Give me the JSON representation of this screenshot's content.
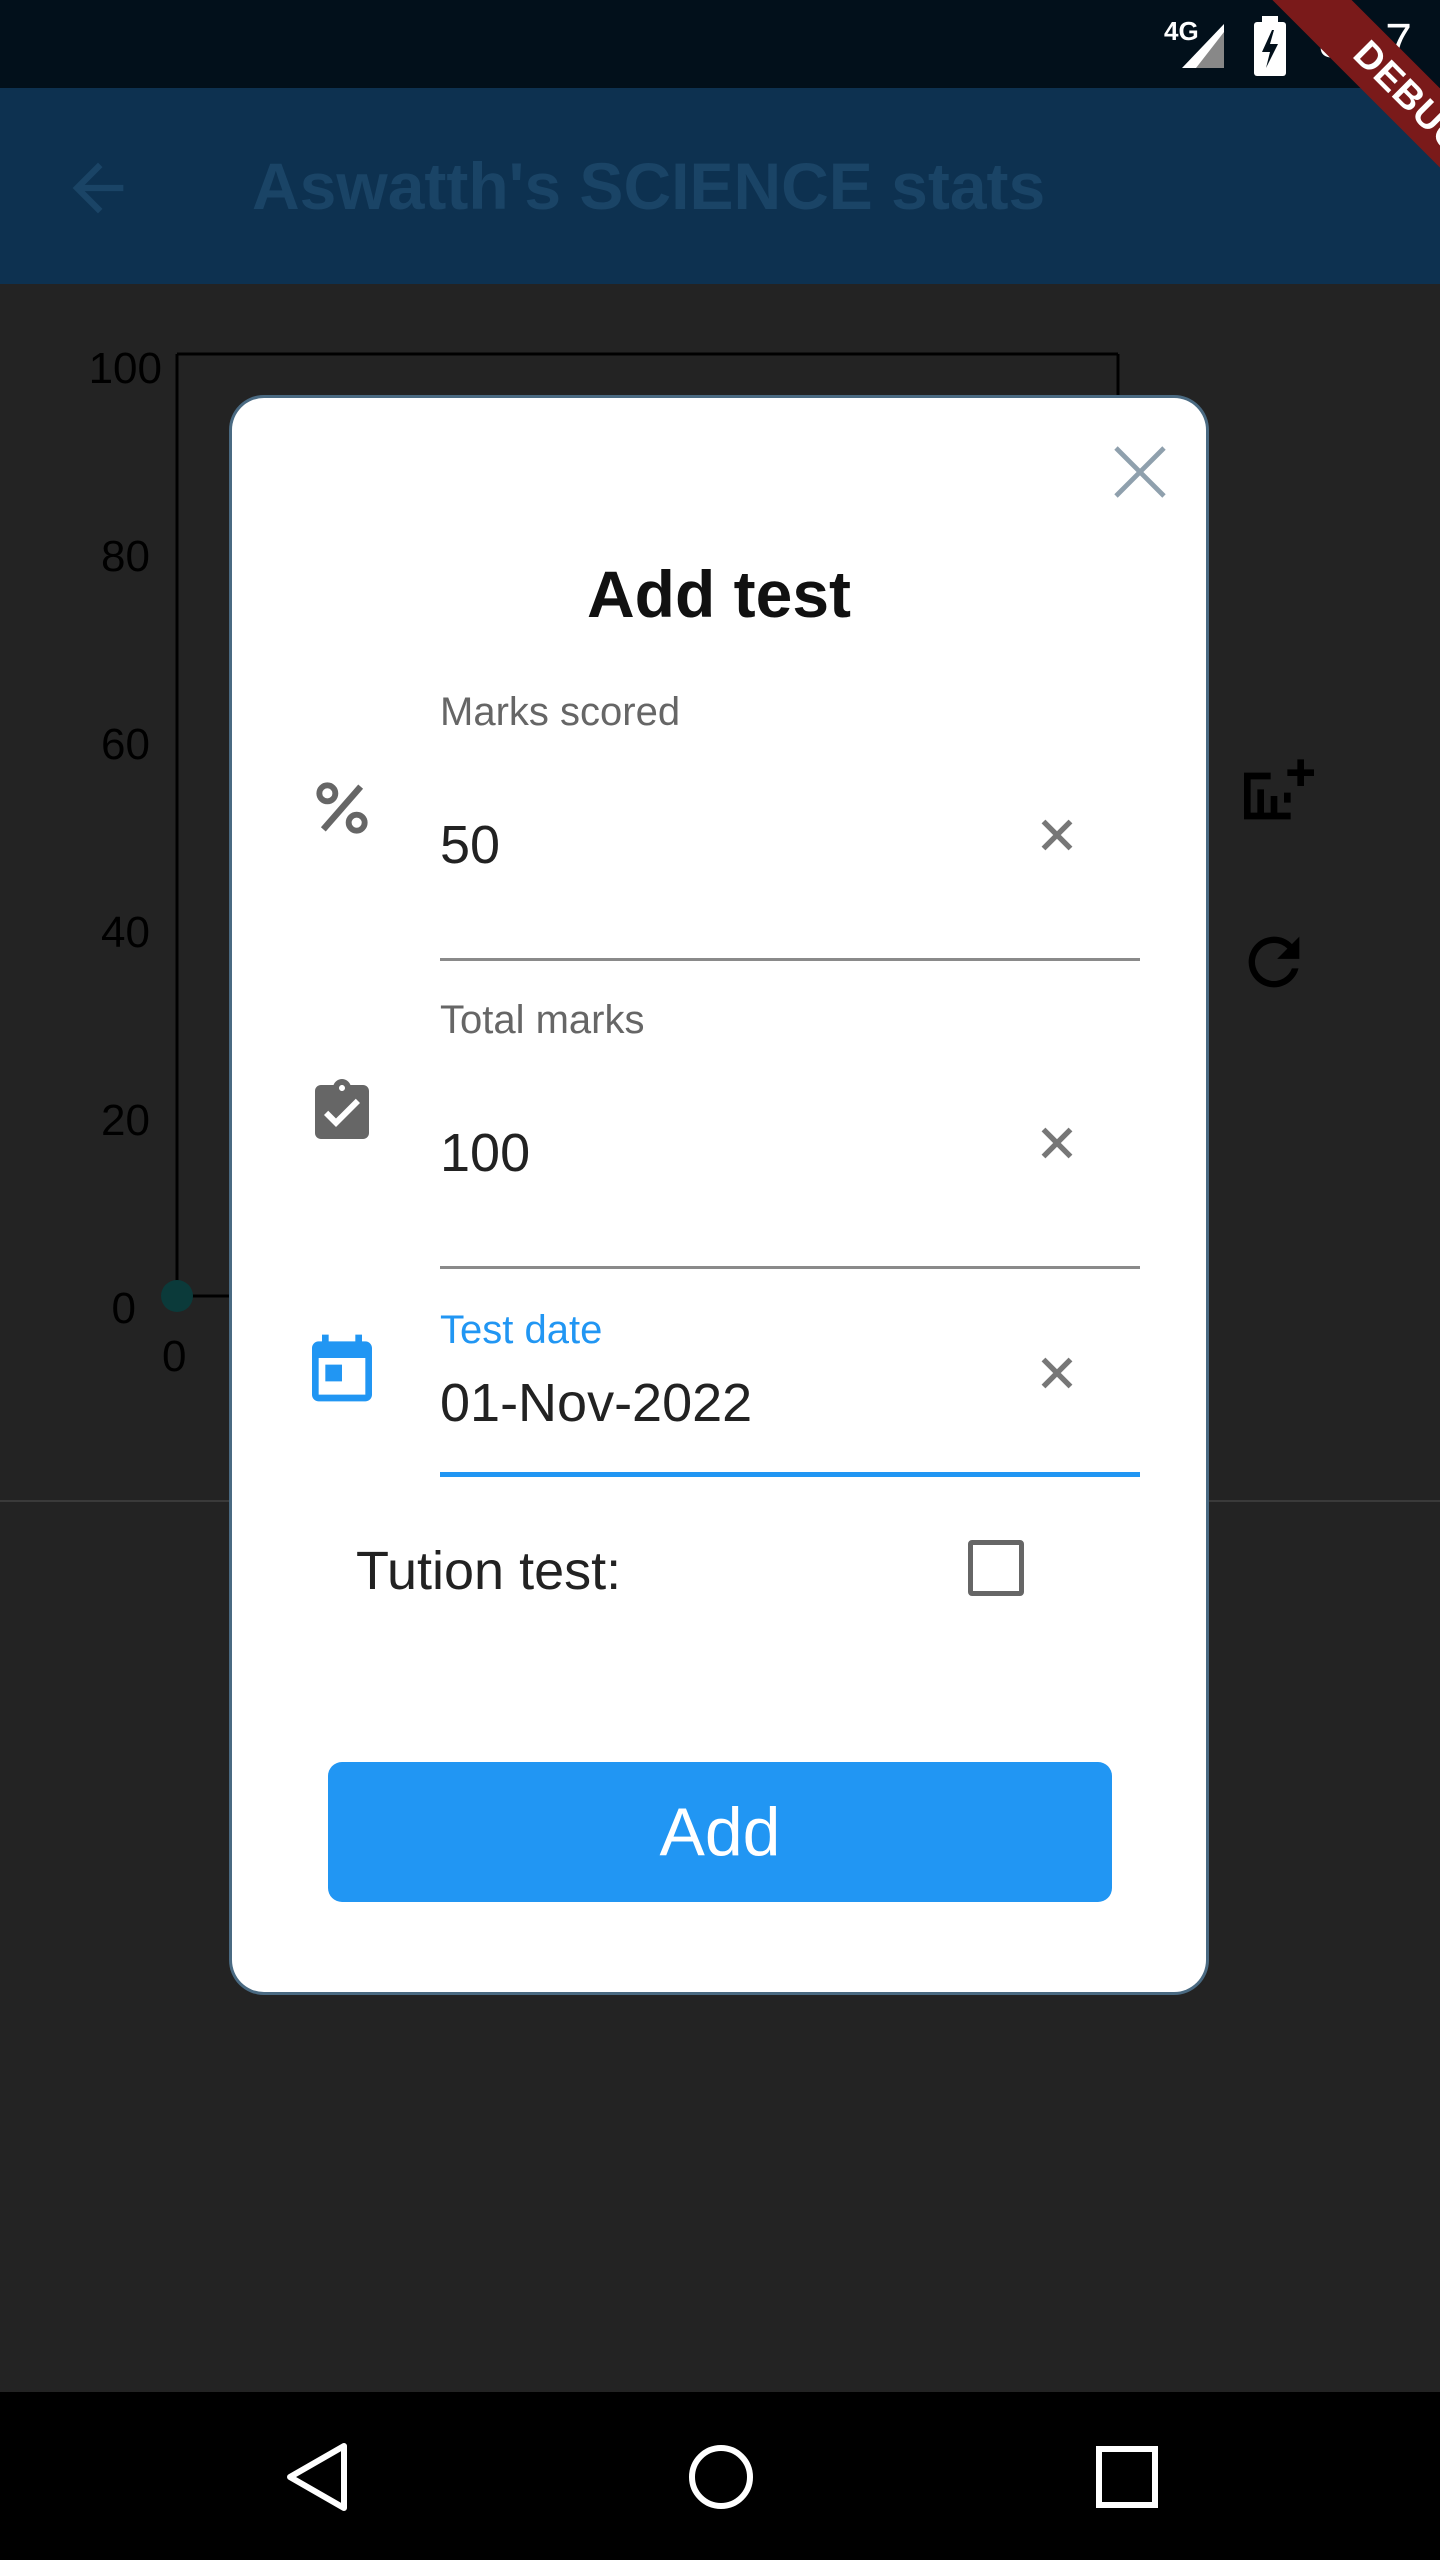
{
  "status_bar": {
    "time": "8:17",
    "network": "4G"
  },
  "app_bar": {
    "title": "Aswatth's SCIENCE stats"
  },
  "chart_data": {
    "type": "line",
    "y_ticks": [
      "100",
      "80",
      "60",
      "40",
      "20",
      "0"
    ],
    "x_ticks": [
      "0"
    ],
    "ylim": [
      0,
      100
    ],
    "series": [
      {
        "points": [
          {
            "x": 0,
            "y": 0
          }
        ]
      }
    ]
  },
  "debug_banner": {
    "label": "DEBUG"
  },
  "dialog": {
    "title": "Add test",
    "fields": [
      {
        "label": "Marks scored",
        "value": "50",
        "icon": "percent-icon"
      },
      {
        "label": "Total marks",
        "value": "100",
        "icon": "clipboard-check-icon"
      },
      {
        "label": "Test date",
        "value": "01-Nov-2022",
        "icon": "calendar-icon"
      }
    ],
    "tution_label": "Tution test:",
    "tution_checked": false,
    "add_label": "Add"
  },
  "colors": {
    "accent": "#2196f3",
    "app_bar": "#0d3150",
    "status_bar": "#02101b"
  }
}
